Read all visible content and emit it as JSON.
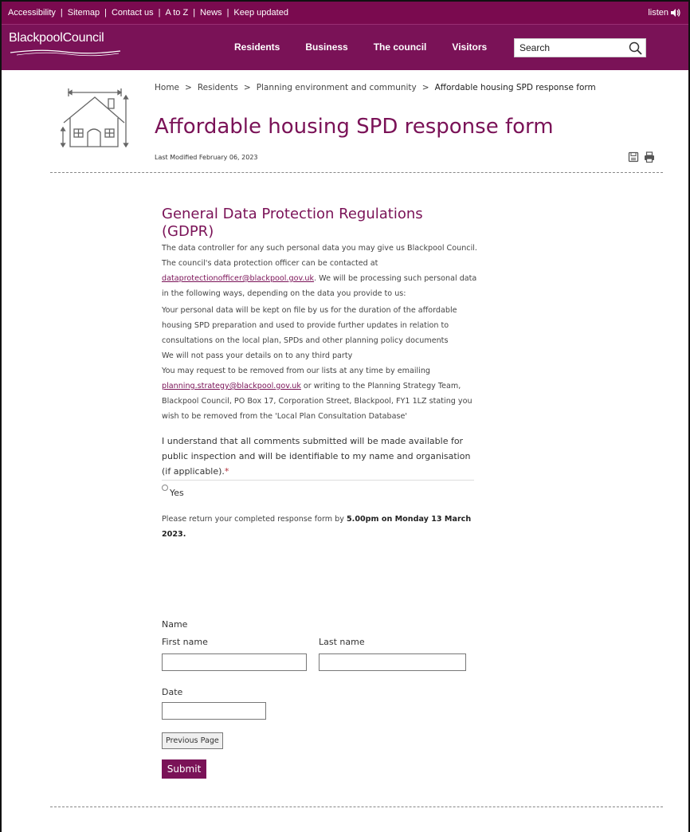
{
  "colors": {
    "brand": "#7a1257",
    "topbar": "#7a0a4f",
    "required": "#b3303b"
  },
  "topbar": {
    "links": [
      "Accessibility",
      "Sitemap",
      "Contact us",
      "A to Z",
      "News",
      "Keep updated"
    ],
    "listen": "listen"
  },
  "nav": {
    "logo": "BlackpoolCouncil",
    "items": [
      "Residents",
      "Business",
      "The council",
      "Visitors"
    ],
    "search_placeholder": "Search"
  },
  "breadcrumb": [
    "Home",
    "Residents",
    "Planning environment and community",
    "Affordable housing SPD response form"
  ],
  "page": {
    "title": "Affordable housing SPD response form",
    "last_modified": "Last Modified February 06, 2023"
  },
  "gdpr": {
    "title": "General Data Protection Regulations (GDPR)",
    "p1_before": "The data controller for any such personal data you may give us Blackpool Council. The council's data protection officer can be contacted at ",
    "p1_email": "dataprotectionofficer@blackpool.gov.uk",
    "p1_after": ". We will be processing such personal data in the following ways, depending on the data you provide to us:",
    "p2": "Your personal data will be kept on file by us for the duration of the affordable housing SPD preparation and used to provide further updates in relation to consultations on the local plan, SPDs and other planning policy documents",
    "p3": "We will not pass your details on to any third party",
    "p4_before": "You may request to be removed from our lists at any time by emailing ",
    "p4_email": "planning.strategy@blackpool.gov.uk",
    "p4_after": " or writing to the Planning Strategy Team, Blackpool Council, PO Box 17, Corporation Street, Blackpool, FY1 1LZ stating you wish to be removed from the 'Local Plan Consultation Database'"
  },
  "form": {
    "acknowledgement": "I understand that all comments submitted will be made available for public inspection and will be identifiable to my name and organisation (if applicable).",
    "required_mark": "*",
    "yes_label": "Yes",
    "deadline_before": "Please return your completed response form by ",
    "deadline_bold": "5.00pm on Monday 13 March 2023.",
    "name_label": "Name",
    "first_name_label": "First name",
    "last_name_label": "Last name",
    "date_label": "Date",
    "previous_button": "Previous Page",
    "submit_button": "Submit"
  }
}
